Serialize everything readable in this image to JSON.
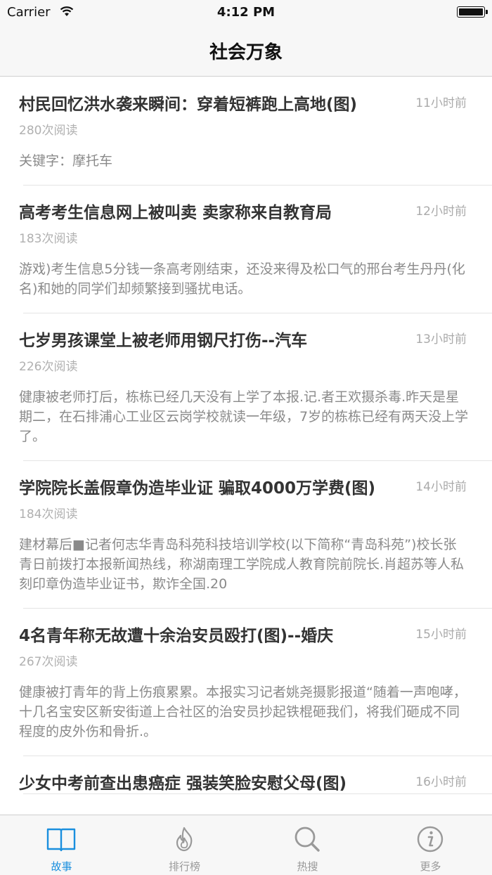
{
  "status_bar": {
    "carrier": "Carrier",
    "time": "4:12 PM"
  },
  "nav": {
    "title": "社会万象"
  },
  "articles": [
    {
      "title": "村民回忆洪水袭来瞬间：穿着短裤跑上高地(图)",
      "time_ago": "11小时前",
      "reads": "280次阅读",
      "summary": "关键字：摩托车"
    },
    {
      "title": "高考考生信息网上被叫卖 卖家称来自教育局",
      "time_ago": "12小时前",
      "reads": "183次阅读",
      "summary": "游戏)考生信息5分钱一条高考刚结束，还没来得及松口气的邢台考生丹丹(化名)和她的同学们却频繁接到骚扰电话。"
    },
    {
      "title": "七岁男孩课堂上被老师用钢尺打伤--汽车",
      "time_ago": "13小时前",
      "reads": "226次阅读",
      "summary": "健康被老师打后，栋栋已经几天没有上学了本报.记.者王欢摄杀毒.昨天是星期二，在石排浦心工业区云岗学校就读一年级，7岁的栋栋已经有两天没上学了。"
    },
    {
      "title": "学院院长盖假章伪造毕业证 骗取4000万学费(图)",
      "time_ago": "14小时前",
      "reads": "184次阅读",
      "summary": "建材幕后■记者何志华青岛科苑科技培训学校(以下简称“青岛科苑”)校长张青日前拨打本报新闻热线，称湖南理工学院成人教育院前院长.肖超苏等人私刻印章伪造毕业证书，欺诈全国.20"
    },
    {
      "title": "4名青年称无故遭十余治安员殴打(图)--婚庆",
      "time_ago": "15小时前",
      "reads": "267次阅读",
      "summary": "健康被打青年的背上伤痕累累。本报实习记者姚尧摄影报道“随着一声咆哮，十几名宝安区新安街道上合社区的治安员抄起铁棍砸我们，将我们砸成不同程度的皮外伤和骨折.。"
    },
    {
      "title": "少女中考前查出患癌症 强装笑脸安慰父母(图)",
      "time_ago": "16小时前",
      "reads": "",
      "summary": ""
    }
  ],
  "tabs": [
    {
      "label": "故事",
      "icon": "book-icon",
      "active": true
    },
    {
      "label": "排行榜",
      "icon": "flame-icon",
      "active": false
    },
    {
      "label": "热搜",
      "icon": "search-icon",
      "active": false
    },
    {
      "label": "更多",
      "icon": "info-icon",
      "active": false
    }
  ],
  "colors": {
    "accent": "#1a8fde",
    "inactive_tab": "#999999",
    "title_text": "#333333",
    "meta_text": "#aaaaaa"
  }
}
